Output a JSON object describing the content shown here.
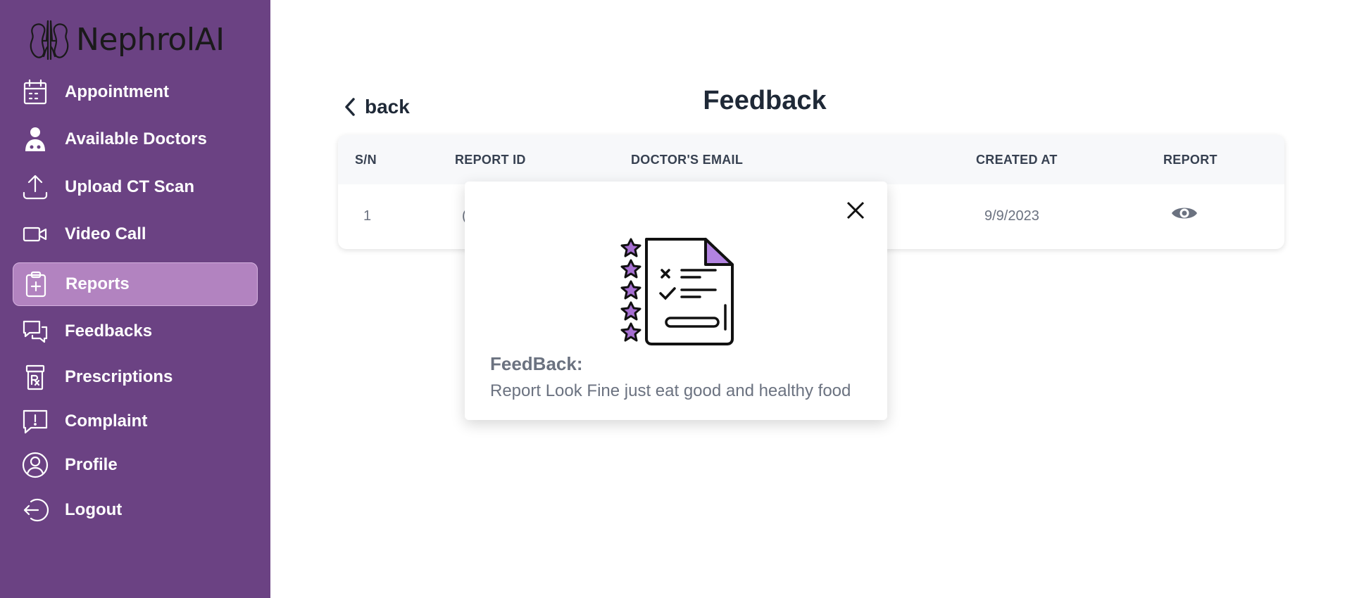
{
  "brand": {
    "name": "NephrolAI",
    "logo_icon": "kidneys-icon"
  },
  "colors": {
    "sidebar": "#6b4283",
    "active_item": "#b283c0",
    "star": "#a66fd1"
  },
  "sidebar": {
    "items": [
      {
        "label": "Appointment",
        "icon": "calendar-icon"
      },
      {
        "label": "Available Doctors",
        "icon": "doctor-icon"
      },
      {
        "label": "Upload CT Scan",
        "icon": "upload-icon"
      },
      {
        "label": "Video Call",
        "icon": "video-icon"
      },
      {
        "label": "Reports",
        "icon": "clipboard-icon",
        "active": true
      },
      {
        "label": "Feedbacks",
        "icon": "chat-icon"
      },
      {
        "label": "Prescriptions",
        "icon": "rx-icon"
      },
      {
        "label": "Complaint",
        "icon": "alert-message-icon"
      },
      {
        "label": "Profile",
        "icon": "user-icon"
      },
      {
        "label": "Logout",
        "icon": "logout-icon"
      }
    ]
  },
  "header": {
    "back_label": "back",
    "title": "Feedback"
  },
  "table": {
    "columns": [
      "S/N",
      "REPORT ID",
      "DOCTOR'S EMAIL",
      "CREATED AT",
      "REPORT"
    ],
    "rows": [
      {
        "sn": "1",
        "report_id": "(",
        "email": "",
        "created_at": "9/9/2023",
        "report_icon": "eye-icon"
      }
    ]
  },
  "modal": {
    "title": "FeedBack:",
    "text": "Report Look Fine just eat good and healthy food",
    "illustration": "rated-document-icon",
    "close_icon": "close-icon"
  }
}
